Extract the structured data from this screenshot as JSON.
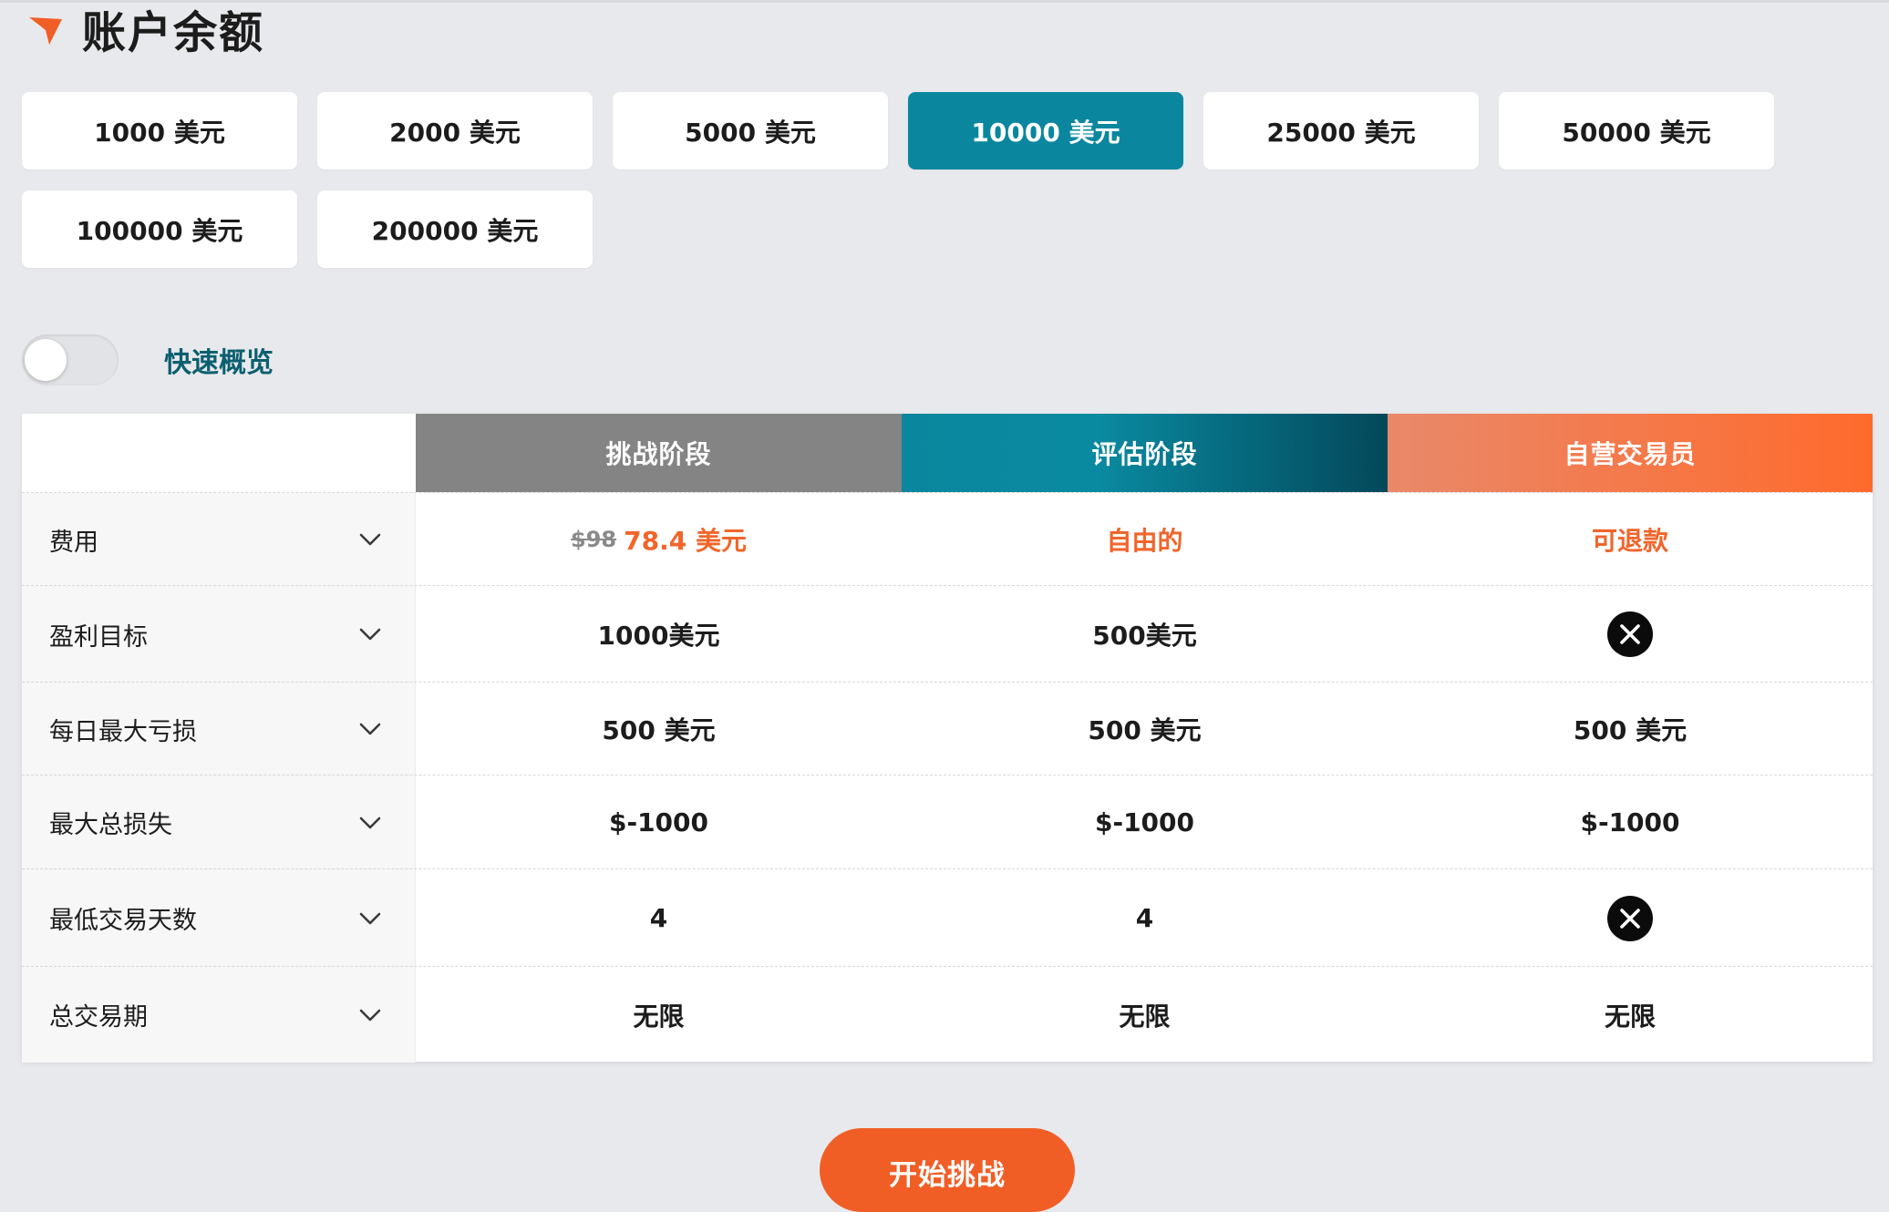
{
  "header": {
    "title": "账户余额",
    "icon": "orange-arrow-icon"
  },
  "balances": [
    {
      "label": "1000 美元",
      "active": false
    },
    {
      "label": "2000 美元",
      "active": false
    },
    {
      "label": "5000 美元",
      "active": false
    },
    {
      "label": "10000 美元",
      "active": true
    },
    {
      "label": "25000 美元",
      "active": false
    },
    {
      "label": "50000 美元",
      "active": false
    },
    {
      "label": "100000 美元",
      "active": false
    },
    {
      "label": "200000 美元",
      "active": false
    }
  ],
  "quick_view": {
    "label": "快速概览",
    "enabled": false
  },
  "table": {
    "columns": [
      "挑战阶段",
      "评估阶段",
      "自营交易员"
    ],
    "rows": [
      {
        "label": "费用",
        "cells": [
          {
            "old": "$98",
            "value": "78.4 美元",
            "style": "orange"
          },
          {
            "value": "自由的",
            "style": "orange"
          },
          {
            "value": "可退款",
            "style": "orange"
          }
        ]
      },
      {
        "label": "盈利目标",
        "cells": [
          {
            "value": "1000美元"
          },
          {
            "value": "500美元"
          },
          {
            "icon": "x-circle-icon"
          }
        ]
      },
      {
        "label": "每日最大亏损",
        "cells": [
          {
            "value": "500 美元"
          },
          {
            "value": "500 美元"
          },
          {
            "value": "500 美元"
          }
        ]
      },
      {
        "label": "最大总损失",
        "cells": [
          {
            "value": "$-1000"
          },
          {
            "value": "$-1000"
          },
          {
            "value": "$-1000"
          }
        ]
      },
      {
        "label": "最低交易天数",
        "cells": [
          {
            "value": "4"
          },
          {
            "value": "4"
          },
          {
            "icon": "x-circle-icon"
          }
        ]
      },
      {
        "label": "总交易期",
        "cells": [
          {
            "value": "无限"
          },
          {
            "value": "无限"
          },
          {
            "value": "无限"
          }
        ]
      }
    ]
  },
  "cta": {
    "label": "开始挑战"
  },
  "colors": {
    "accent_teal": "#0a879e",
    "accent_orange": "#f15e25",
    "background": "#e8e9ec"
  }
}
